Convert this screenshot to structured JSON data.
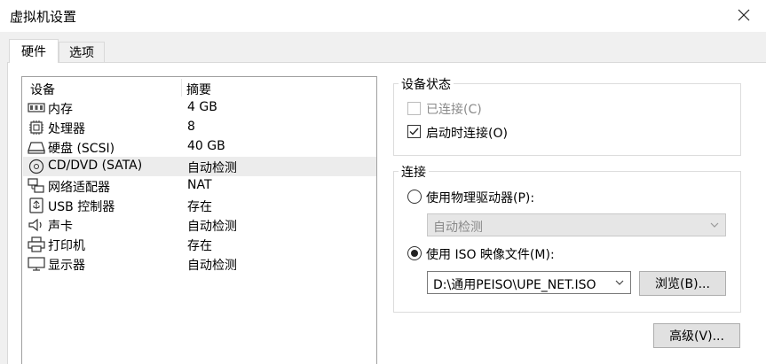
{
  "window": {
    "title": "虚拟机设置"
  },
  "tabs": [
    {
      "label": "硬件",
      "active": true
    },
    {
      "label": "选项",
      "active": false
    }
  ],
  "device_list": {
    "headers": {
      "device": "设备",
      "summary": "摘要"
    },
    "rows": [
      {
        "icon": "memory-icon",
        "name": "内存",
        "summary": "4 GB",
        "selected": false
      },
      {
        "icon": "processor-icon",
        "name": "处理器",
        "summary": "8",
        "selected": false
      },
      {
        "icon": "harddisk-icon",
        "name": "硬盘 (SCSI)",
        "summary": "40 GB",
        "selected": false
      },
      {
        "icon": "cd-dvd-icon",
        "name": "CD/DVD (SATA)",
        "summary": "自动检测",
        "selected": true
      },
      {
        "icon": "network-adapter-icon",
        "name": "网络适配器",
        "summary": "NAT",
        "selected": false
      },
      {
        "icon": "usb-icon",
        "name": "USB 控制器",
        "summary": "存在",
        "selected": false
      },
      {
        "icon": "sound-icon",
        "name": "声卡",
        "summary": "自动检测",
        "selected": false
      },
      {
        "icon": "printer-icon",
        "name": "打印机",
        "summary": "存在",
        "selected": false
      },
      {
        "icon": "display-icon",
        "name": "显示器",
        "summary": "自动检测",
        "selected": false
      }
    ]
  },
  "device_status": {
    "label": "设备状态",
    "connected": {
      "label": "已连接(C)",
      "checked": false,
      "disabled": true
    },
    "connect_at_power_on": {
      "label": "启动时连接(O)",
      "checked": true,
      "disabled": false
    }
  },
  "connection": {
    "label": "连接",
    "physical_drive": {
      "label": "使用物理驱动器(P):",
      "selected": false,
      "value": "自动检测"
    },
    "iso_image": {
      "label": "使用 ISO 映像文件(M):",
      "selected": true,
      "value": "D:\\通用PEISO\\UPE_NET.ISO"
    },
    "browse_label": "浏览(B)..."
  },
  "advanced_label": "高级(V)...",
  "colors": {
    "dialog_bg": "#f0f0f0",
    "selected_row": "#ececec",
    "disabled_text": "#8a8a8a"
  }
}
